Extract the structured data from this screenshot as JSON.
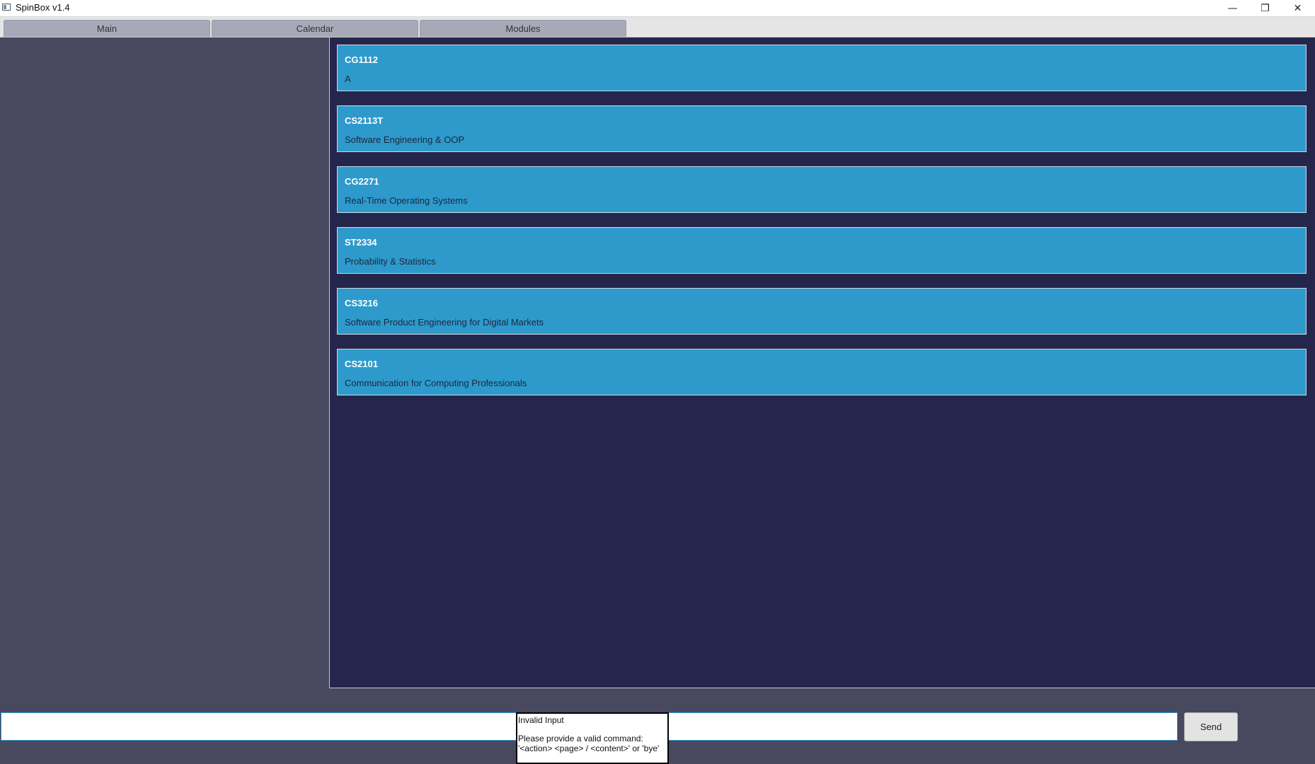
{
  "window": {
    "title": "SpinBox v1.4",
    "minimize_glyph": "—",
    "maximize_glyph": "❐",
    "close_glyph": "✕"
  },
  "tabs": [
    {
      "label": "Main"
    },
    {
      "label": "Calendar"
    },
    {
      "label": "Modules"
    }
  ],
  "modules": [
    {
      "code": "CG1112",
      "name": "A"
    },
    {
      "code": "CS2113T",
      "name": "Software Engineering & OOP"
    },
    {
      "code": "CG2271",
      "name": "Real-Time Operating Systems"
    },
    {
      "code": "ST2334",
      "name": "Probability & Statistics"
    },
    {
      "code": "CS3216",
      "name": "Software Product Engineering for Digital Markets"
    },
    {
      "code": "CS2101",
      "name": "Communication for Computing Professionals"
    }
  ],
  "command": {
    "value": "",
    "send_label": "Send"
  },
  "tooltip": {
    "title": "Invalid Input",
    "line1": "Please provide a valid command:",
    "line2": "'<action> <page> / <content>' or 'bye'"
  },
  "colors": {
    "module_card": "#2e9acb",
    "module_area": "#25264b",
    "side_panel": "#48485f",
    "input_border": "#2f9bd7"
  }
}
